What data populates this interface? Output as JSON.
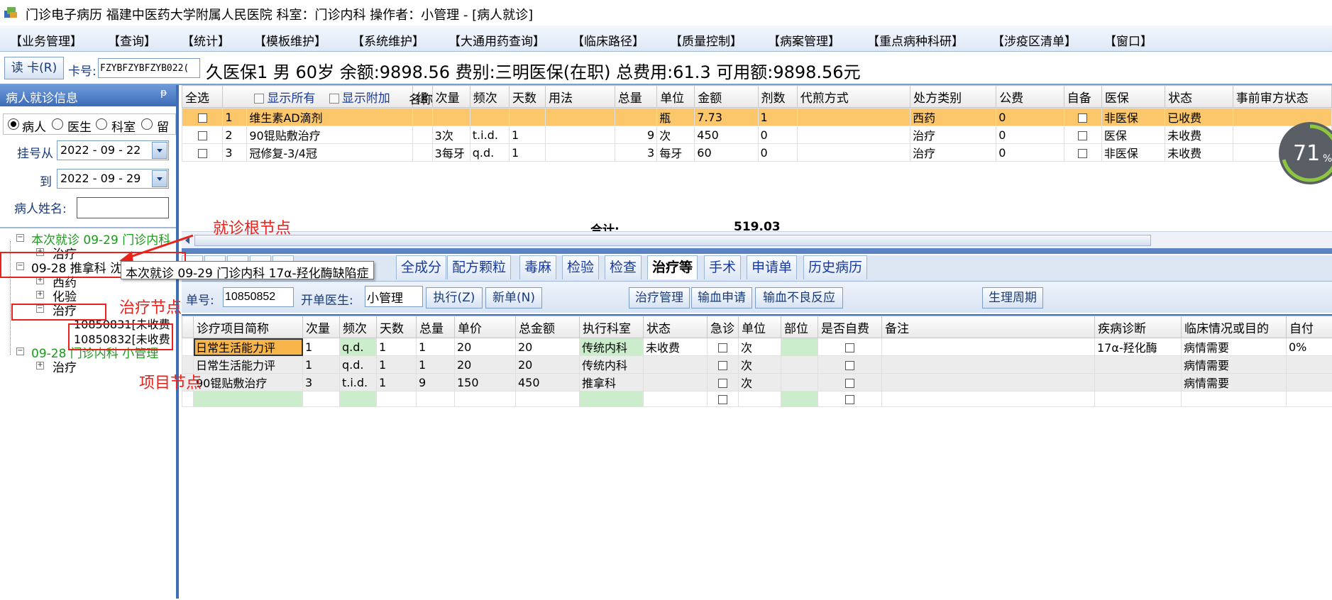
{
  "title_bar": {
    "text": "门诊电子病历  福建中医药大学附属人民医院  科室：门诊内科  操作者：小管理 - [病人就诊]"
  },
  "menu": [
    "【业务管理】",
    "【查询】",
    "【统计】",
    "【模板维护】",
    "【系统维护】",
    "【大通用药查询】",
    "【临床路径】",
    "【质量控制】",
    "【病案管理】",
    "【重点病种科研】",
    "【涉疫区清单】",
    "【窗口】"
  ],
  "patient_bar": {
    "read_card_button": "读 卡(R)",
    "card_label": "卡号:",
    "card_value": "FZYBFZYBFZYB022(",
    "info": "久医保1 男  60岁  余额:9898.56  费别:三明医保(在职) 总费用:61.3  可用额:9898.56元"
  },
  "left_panel": {
    "header": "病人就诊信息",
    "pin": "ᵽ",
    "radio_options": [
      {
        "label": "病人",
        "checked": true
      },
      {
        "label": "医生",
        "checked": false
      },
      {
        "label": "科室",
        "checked": false
      },
      {
        "label": "留",
        "checked": false
      }
    ],
    "date_from_label": "挂号从",
    "date_from": "2022 - 09 - 22",
    "date_to_label": "到",
    "date_to": "2022 - 09 - 29",
    "patient_name_label": "病人姓名:",
    "patient_name_value": "",
    "tree": {
      "visit_current": "本次就诊  09-29  门诊内科",
      "current_child": "治疗",
      "visit_0928_a": "09-28  推拿科  沈",
      "xiyao": "西药",
      "huayan": "化验",
      "zhiliao": "治疗",
      "item1": "10850831[未收费",
      "item2": "10850832[未收费",
      "visit_0928_b": "09-28  门诊内科  小管理",
      "b_child": "治疗"
    },
    "tooltip": "本次就诊  09-29  门诊内科  17α-羟化酶缺陷症"
  },
  "annotations": {
    "root": "就诊根节点",
    "treatment": "治疗节点",
    "item": "项目节点"
  },
  "rx_table": {
    "select_all": "全选",
    "show_all": "显示所有",
    "show_extra": "显示附加",
    "headers": [
      "名称",
      "组",
      "次量",
      "频次",
      "天数",
      "用法",
      "总量",
      "单位",
      "金额",
      "剂数",
      "代煎方式",
      "处方类别",
      "公费",
      "自备",
      "医保",
      "状态",
      "事前审方状态"
    ],
    "rows": [
      {
        "no": "1",
        "name": "维生素AD滴剂",
        "group": "",
        "dose": "",
        "freq": "",
        "days": "",
        "usage": "",
        "total": "",
        "unit": "瓶",
        "amount": "7.73",
        "count": "1",
        "decoct": "",
        "category": "西药",
        "public": "0",
        "self": "",
        "insurance": "非医保",
        "status": "已收费",
        "audit": ""
      },
      {
        "no": "2",
        "name": "90锟贴敷治疗",
        "group": "",
        "dose": "3次",
        "freq": "t.i.d.",
        "days": "1",
        "usage": "",
        "total": "9",
        "unit": "次",
        "amount": "450",
        "count": "0",
        "decoct": "",
        "category": "治疗",
        "public": "0",
        "self": "",
        "insurance": "医保",
        "status": "未收费",
        "audit": ""
      },
      {
        "no": "3",
        "name": "冠修复-3/4冠",
        "group": "",
        "dose": "3每牙",
        "freq": "q.d.",
        "days": "1",
        "usage": "",
        "total": "3",
        "unit": "每牙",
        "amount": "60",
        "count": "0",
        "decoct": "",
        "category": "治疗",
        "public": "0",
        "self": "",
        "insurance": "非医保",
        "status": "未收费",
        "audit": ""
      }
    ],
    "sum_label": "合计:",
    "sum_value": "519.03"
  },
  "gauge": {
    "value": "71",
    "unit": "%",
    "percent": 71
  },
  "tabs": [
    "全成分",
    "配方颗粒",
    "毒麻",
    "检验",
    "检查",
    "治疗等",
    "手术",
    "申请单",
    "历史病历"
  ],
  "active_tab": "治疗等",
  "order_bar": {
    "order_label": "单号:",
    "order_value": "10850852",
    "doctor_label": "开单医生:",
    "doctor_value": "小管理",
    "buttons": [
      "执行(Z)",
      "新单(N)",
      "治疗管理",
      "输血申请",
      "输血不良反应",
      "生理周期"
    ]
  },
  "treat_table": {
    "headers": [
      "诊疗项目简称",
      "次量",
      "频次",
      "天数",
      "总量",
      "单价",
      "总金额",
      "执行科室",
      "状态",
      "急诊",
      "单位",
      "部位",
      "是否自费",
      "备注",
      "疾病诊断",
      "临床情况或目的",
      "自付"
    ],
    "rows": [
      {
        "name": "日常生活能力评",
        "dose": "1",
        "freq": "q.d.",
        "days": "1",
        "total": "1",
        "price": "20",
        "amount": "20",
        "dept": "传统内科",
        "status": "未收费",
        "unit": "次",
        "diagnosis": "17α-羟化酶",
        "purpose": "病情需要",
        "selfpay": "0%"
      },
      {
        "name": "日常生活能力评",
        "dose": "1",
        "freq": "q.d.",
        "days": "1",
        "total": "1",
        "price": "20",
        "amount": "20",
        "dept": "传统内科",
        "status": "",
        "unit": "次",
        "diagnosis": "",
        "purpose": "病情需要",
        "selfpay": ""
      },
      {
        "name": "90锟贴敷治疗",
        "dose": "3",
        "freq": "t.i.d.",
        "days": "1",
        "total": "9",
        "price": "150",
        "amount": "450",
        "dept": "推拿科",
        "status": "",
        "unit": "次",
        "diagnosis": "",
        "purpose": "病情需要",
        "selfpay": ""
      }
    ]
  },
  "colors": {
    "accent": "#3e6fb6",
    "highlight": "#fcc66b",
    "annotation": "#e8231c",
    "green_cell": "#ccedcc"
  }
}
